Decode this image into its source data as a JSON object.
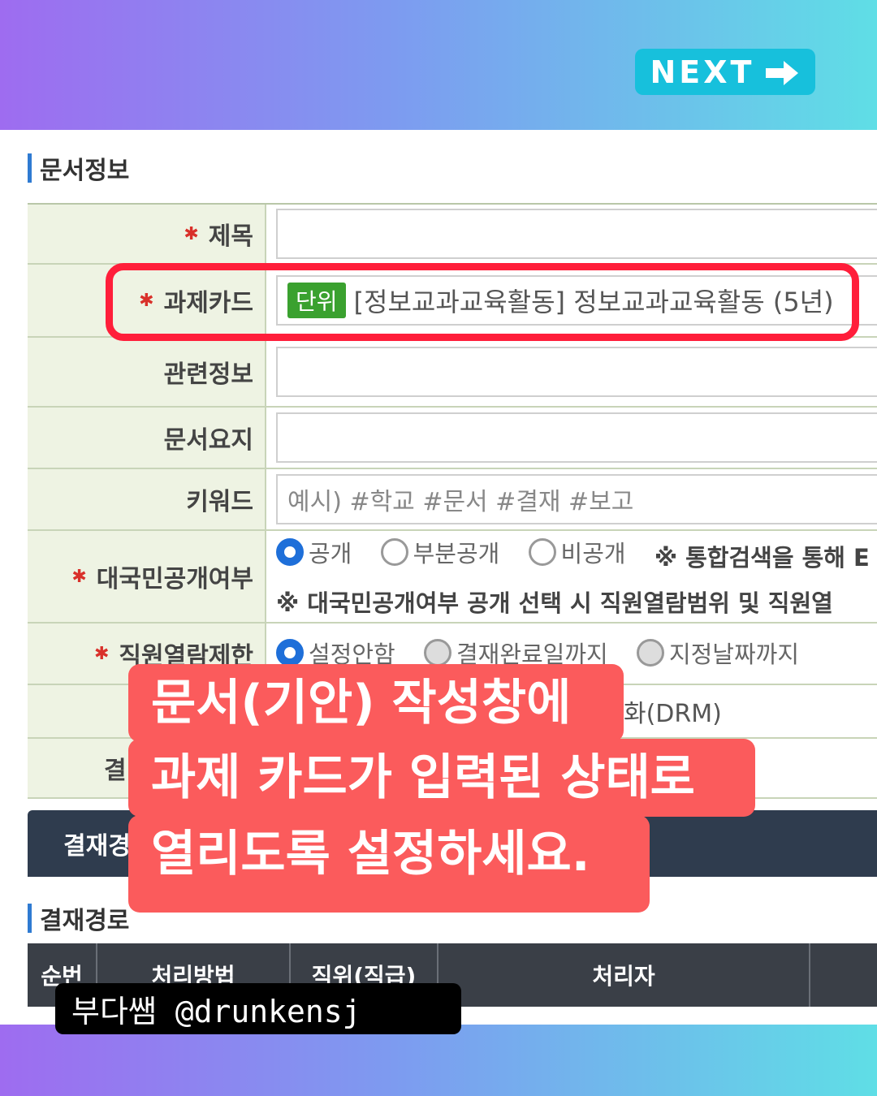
{
  "next_button": {
    "label": "NEXT",
    "icon": "right-arrow-icon"
  },
  "doc_info_title": "문서정보",
  "form": {
    "title_label": "제목",
    "task_card_label": "과제카드",
    "task_card_tag": "단위",
    "task_card_value": "[정보교과교육활동] 정보교과교육활동 (5년)",
    "related_label": "관련정보",
    "summary_label": "문서요지",
    "keyword_label": "키워드",
    "keyword_placeholder": "예시) #학교 #문서 #결재 #보고",
    "disclosure_label": "대국민공개여부",
    "disclosure_options": [
      "공개",
      "부분공개",
      "비공개"
    ],
    "disclosure_note": "※ 통합검색을 통해 E",
    "disclosure_note2": "※ 대국민공개여부 공개 선택 시 직원열람범위 및 직원열",
    "staff_label": "직원열람제한",
    "staff_options": [
      "설정안함",
      "결재완료일까지",
      "지정날짜까지"
    ],
    "drm_text": "화(DRM)",
    "partial_label": "결"
  },
  "approval_tab": "결재경",
  "approval_route_title": "결재경로",
  "grid_headers": [
    "순번",
    "처리방법",
    "직위(직급)",
    "처리자"
  ],
  "caption_lines": [
    "문서(기안) 작성창에",
    "과제 카드가 입력된 상태로",
    "열리도록 설정하세요."
  ],
  "credit": "부다쌤 @drunkensj",
  "colors": {
    "accent_red": "#fb5b5c",
    "highlight": "#ff1e3a",
    "next_bg": "#17c0dc"
  }
}
